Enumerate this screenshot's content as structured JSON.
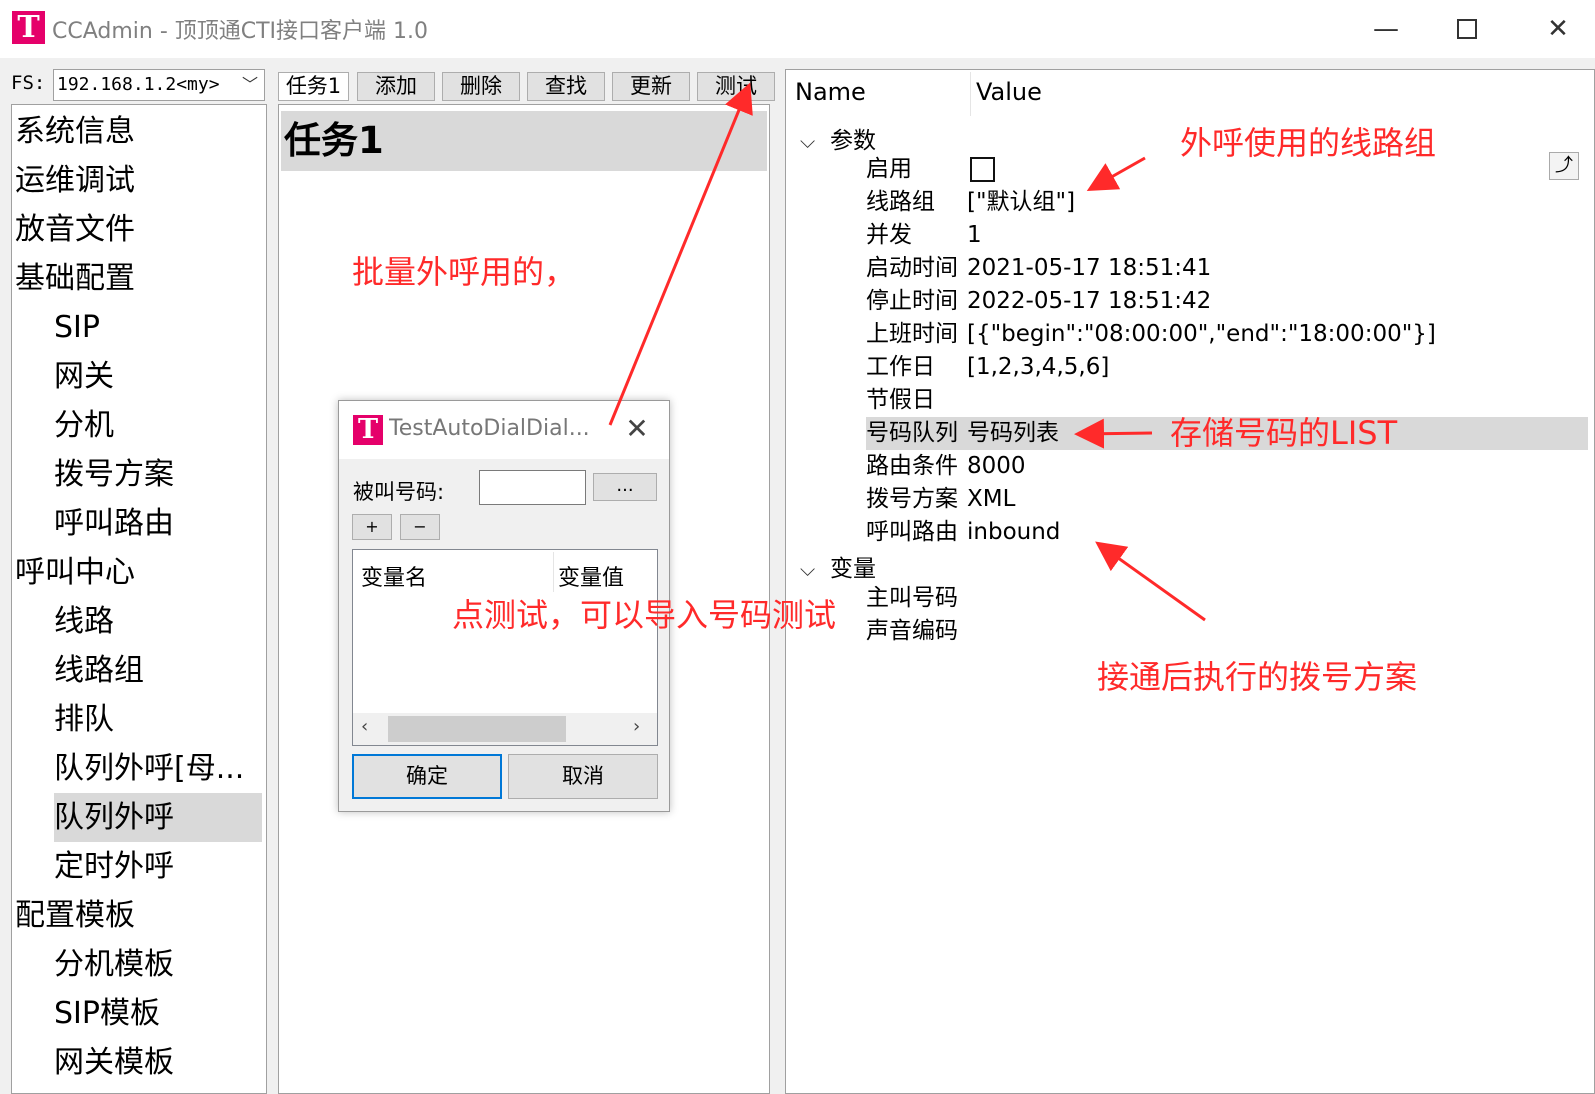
{
  "window": {
    "logo": "T",
    "title": "CCAdmin - 顶顶通CTI接口客户端 1.0",
    "minimize": "—",
    "close": "✕"
  },
  "fs": {
    "label": "FS:",
    "value": "192.168.1.2<my>",
    "chevron": "﹀"
  },
  "nav": {
    "items": [
      {
        "label": "系统信息"
      },
      {
        "label": "运维调试"
      },
      {
        "label": "放音文件"
      },
      {
        "label": "基础配置"
      },
      {
        "label": "SIP"
      },
      {
        "label": "网关"
      },
      {
        "label": "分机"
      },
      {
        "label": "拨号方案"
      },
      {
        "label": "呼叫路由"
      },
      {
        "label": "呼叫中心"
      },
      {
        "label": "线路"
      },
      {
        "label": "线路组"
      },
      {
        "label": "排队"
      },
      {
        "label": "队列外呼[母..."
      },
      {
        "label": "队列外呼"
      },
      {
        "label": "定时外呼"
      },
      {
        "label": "配置模板"
      },
      {
        "label": "分机模板"
      },
      {
        "label": "SIP模板"
      },
      {
        "label": "网关模板"
      }
    ]
  },
  "toolbar": {
    "task_tab": "任务1",
    "add": "添加",
    "delete": "删除",
    "find": "查找",
    "update": "更新",
    "test": "测试"
  },
  "task_list": {
    "items": [
      {
        "label": "任务1"
      }
    ]
  },
  "property_grid": {
    "col_name": "Name",
    "col_value": "Value",
    "side_button": "⤴",
    "groups": [
      {
        "label": "参数",
        "rows": [
          {
            "key": "启用",
            "value": ""
          },
          {
            "key": "线路组",
            "value": "[\"默认组\"]"
          },
          {
            "key": "并发",
            "value": "1"
          },
          {
            "key": "启动时间",
            "value": "2021-05-17 18:51:41"
          },
          {
            "key": "停止时间",
            "value": "2022-05-17 18:51:42"
          },
          {
            "key": "上班时间",
            "value": "[{\"begin\":\"08:00:00\",\"end\":\"18:00:00\"}]"
          },
          {
            "key": "工作日",
            "value": "[1,2,3,4,5,6]"
          },
          {
            "key": "节假日",
            "value": ""
          },
          {
            "key": "号码队列",
            "value": "号码列表"
          },
          {
            "key": "路由条件",
            "value": "8000"
          },
          {
            "key": "拨号方案",
            "value": "XML"
          },
          {
            "key": "呼叫路由",
            "value": "inbound"
          }
        ]
      },
      {
        "label": "变量",
        "rows": [
          {
            "key": "主叫号码",
            "value": ""
          },
          {
            "key": "声音编码",
            "value": ""
          }
        ]
      }
    ],
    "enable_checked": false
  },
  "dialog": {
    "logo": "T",
    "title": "TestAutoDialDial...",
    "close": "✕",
    "called_label": "被叫号码:",
    "called_value": "",
    "browse": "...",
    "plus": "+",
    "minus": "−",
    "col_var_name": "变量名",
    "col_var_value": "变量值",
    "scroll_left": "‹",
    "scroll_right": "›",
    "ok": "确定",
    "cancel": "取消"
  },
  "annotations": {
    "batch_call": "批量外呼用的，",
    "line_group": "外呼使用的线路组",
    "number_list": "存储号码的LIST",
    "click_test": "点测试，可以导入号码测试",
    "dialplan": "接通后执行的拨号方案",
    "color": "#ff2a2a"
  },
  "colors": {
    "logo": "#e5006a",
    "selection": "#d9d9d9",
    "default_button_border": "#0078d7"
  }
}
